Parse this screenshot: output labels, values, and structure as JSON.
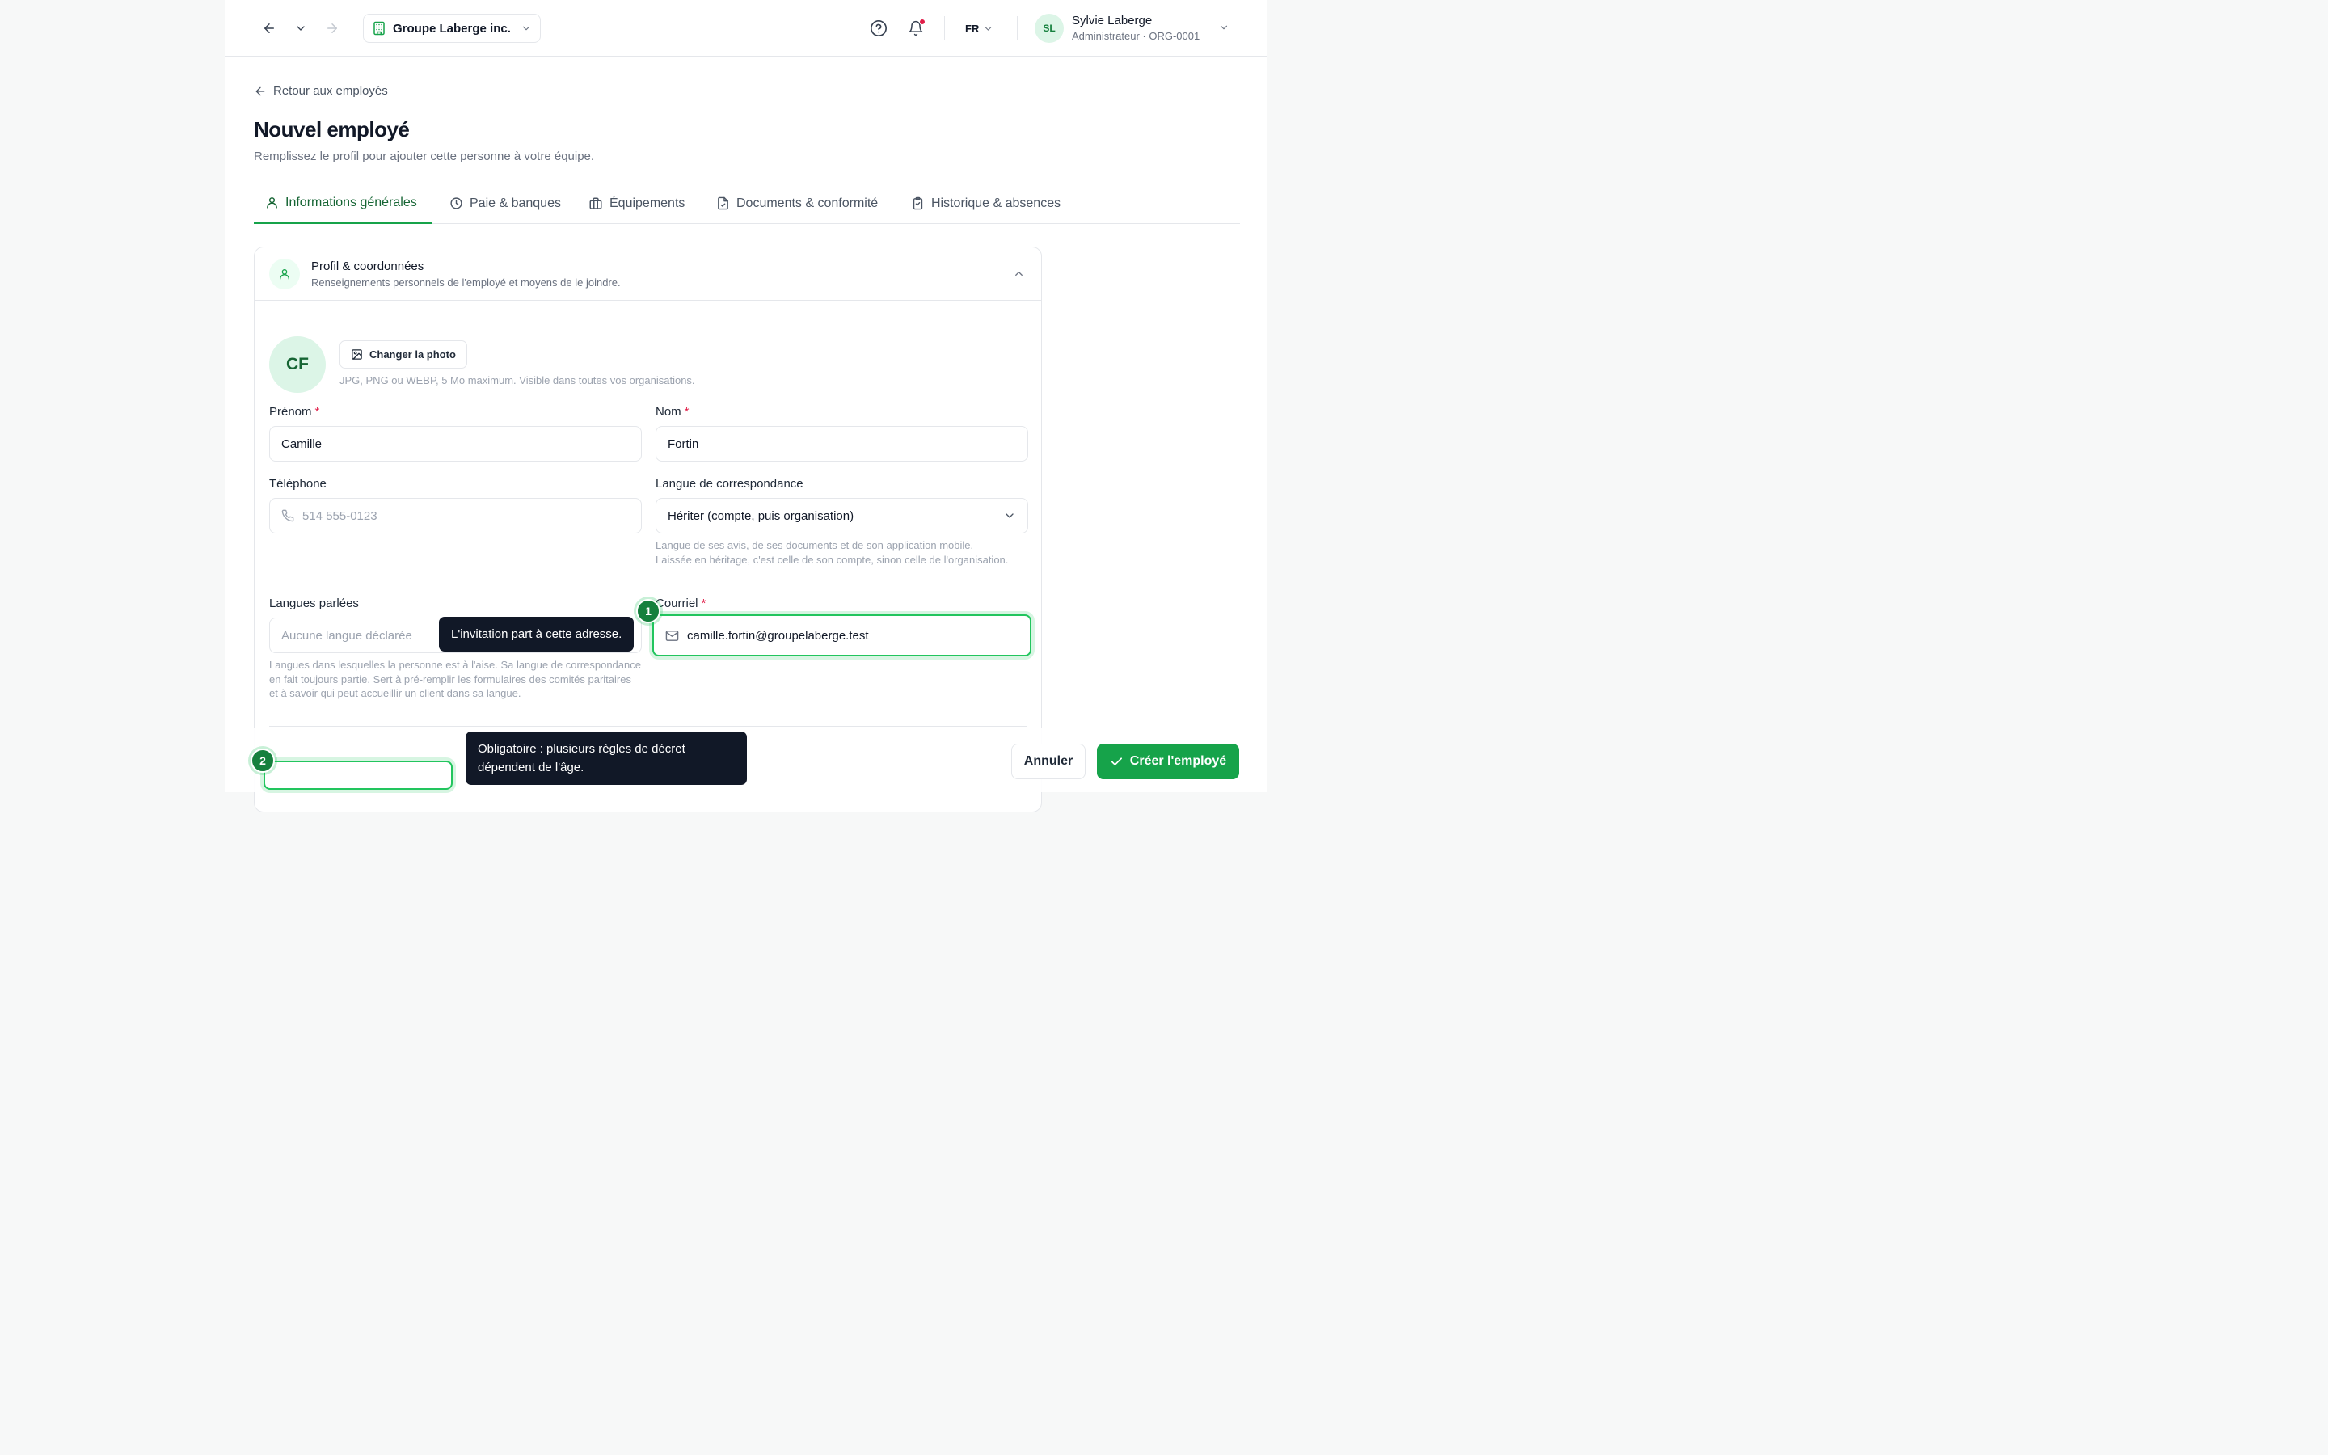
{
  "header": {
    "org_name": "Groupe Laberge inc.",
    "language": "FR",
    "user": {
      "initials": "SL",
      "name": "Sylvie Laberge",
      "role": "Administrateur · ORG-0001"
    }
  },
  "page": {
    "back_label": "Retour aux employés",
    "title": "Nouvel employé",
    "subtitle": "Remplissez le profil pour ajouter cette personne à votre équipe."
  },
  "tabs": [
    {
      "label": "Informations générales",
      "icon": "user-icon",
      "active": true
    },
    {
      "label": "Paie & banques",
      "icon": "clock-icon",
      "active": false
    },
    {
      "label": "Équipements",
      "icon": "briefcase-icon",
      "active": false
    },
    {
      "label": "Documents & conformité",
      "icon": "file-check-icon",
      "active": false
    },
    {
      "label": "Historique & absences",
      "icon": "clipboard-icon",
      "active": false
    }
  ],
  "section": {
    "title": "Profil & coordonnées",
    "description": "Renseignements personnels de l'employé et moyens de le joindre."
  },
  "photo": {
    "initials": "CF",
    "button_label": "Changer la photo",
    "hint": "JPG, PNG ou WEBP, 5 Mo maximum. Visible dans toutes vos organisations."
  },
  "form": {
    "first_name": {
      "label": "Prénom",
      "required": "*",
      "value": "Camille"
    },
    "last_name": {
      "label": "Nom",
      "required": "*",
      "value": "Fortin"
    },
    "phone": {
      "label": "Téléphone",
      "placeholder": "514 555-0123"
    },
    "correspondence_language": {
      "label": "Langue de correspondance",
      "value": "Hériter (compte, puis organisation)",
      "help": "Langue de ses avis, de ses documents et de son application mobile. Laissée en héritage, c'est celle de son compte, sinon celle de l'organisation."
    },
    "spoken_languages": {
      "label": "Langues parlées",
      "placeholder": "Aucune langue déclarée",
      "help": "Langues dans lesquelles la personne est à l'aise. Sa langue de correspondance en fait toujours partie. Sert à pré-remplir les formulaires des comités paritaires et à savoir qui peut accueillir un client dans sa langue."
    },
    "email": {
      "label": "Courriel",
      "required": "*",
      "value": "camille.fortin@groupelaberge.test"
    }
  },
  "tour": {
    "step1": {
      "number": "1",
      "tooltip": "L'invitation part à cette adresse."
    },
    "step2": {
      "number": "2",
      "tooltip": "Obligatoire : plusieurs règles de décret dépendent de l'âge."
    }
  },
  "footer": {
    "cancel_label": "Annuler",
    "create_label": "Créer l'employé"
  },
  "colors": {
    "accent": "#16a34a",
    "accent_dark": "#15803d",
    "required": "#e11d48",
    "tooltip_bg": "#111827"
  }
}
